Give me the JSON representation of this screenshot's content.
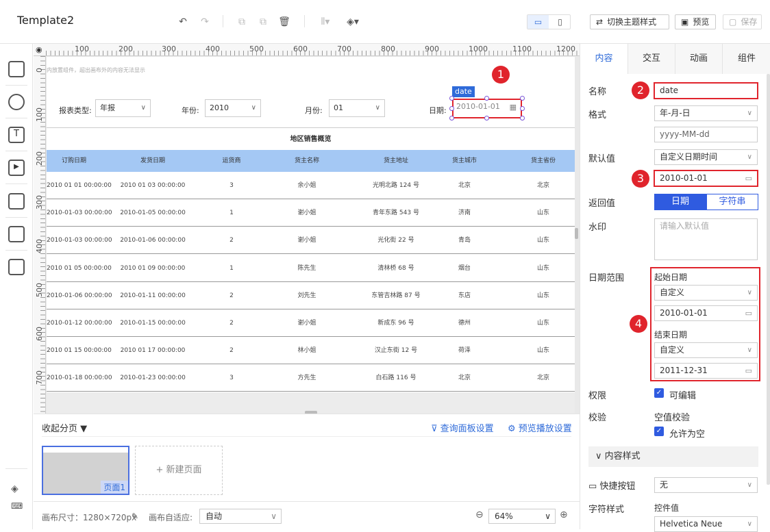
{
  "app": {
    "title": "Template2"
  },
  "toolbar": {
    "undo": "↶",
    "redo": "↷",
    "theme_label": "切换主题样式",
    "preview_label": "预览",
    "save_label": "保存"
  },
  "ruler": {
    "h_labels": [
      "100",
      "200",
      "300",
      "400",
      "500",
      "600",
      "700",
      "800",
      "900",
      "1000",
      "1100",
      "1200"
    ],
    "v_labels": [
      "0",
      "100",
      "200",
      "300",
      "400",
      "500",
      "600",
      "700"
    ]
  },
  "report": {
    "hint": "内放置组件，超出画布外的内容无法显示",
    "query": {
      "type_label": "报表类型:",
      "type_value": "年报",
      "year_label": "年份:",
      "year_value": "2010",
      "month_label": "月份:",
      "month_value": "01",
      "date_label": "日期:",
      "date_value": "2010-01-01",
      "date_tag": "date"
    },
    "table_title": "地区销售概览",
    "columns": [
      "订购日期",
      "发货日期",
      "运货商",
      "货主名称",
      "货主地址",
      "货主城市",
      "货主省份"
    ],
    "rows": [
      [
        "2010 01 01 00:00:00",
        "2010 01 03 00:00:00",
        "3",
        "余小姐",
        "光明北路 124 号",
        "北京",
        "北京"
      ],
      [
        "2010-01-03 00:00:00",
        "2010-01-05 00:00:00",
        "1",
        "谢小姐",
        "青年东路 543 号",
        "济南",
        "山东"
      ],
      [
        "2010-01-03 00:00:00",
        "2010-01-06 00:00:00",
        "2",
        "谢小姐",
        "光化街 22 号",
        "青岛",
        "山东"
      ],
      [
        "2010 01 05 00:00:00",
        "2010 01 09 00:00:00",
        "1",
        "陈先生",
        "清林桥 68 号",
        "烟台",
        "山东"
      ],
      [
        "2010-01-06 00:00:00",
        "2010-01-11 00:00:00",
        "2",
        "刘先生",
        "东管吉林路 87 号",
        "东店",
        "山东"
      ],
      [
        "2010-01-12 00:00:00",
        "2010-01-15 00:00:00",
        "2",
        "谢小姐",
        "新成东 96 号",
        "德州",
        "山东"
      ],
      [
        "2010 01 15 00:00:00",
        "2010 01 17 00:00:00",
        "2",
        "林小姐",
        "汉止东街 12 号",
        "荷泽",
        "山东"
      ],
      [
        "2010-01-18 00:00:00",
        "2010-01-23 00:00:00",
        "3",
        "方先生",
        "白石路 116 号",
        "北京",
        "北京"
      ]
    ]
  },
  "pages": {
    "collapse_label": "收起分页 ▼",
    "query_panel_label": "查询面板设置",
    "preview_play_label": "预览播放设置",
    "thumb_label": "页面1",
    "new_page_label": "+ 新建页面"
  },
  "status": {
    "canvas_size": "画布尺寸：1280×720px",
    "adapt_label": "画布自适应:",
    "adapt_value": "自动",
    "zoom_value": "64%"
  },
  "panel": {
    "tabs": [
      "内容",
      "交互",
      "动画",
      "组件"
    ],
    "name_label": "名称",
    "name_value": "date",
    "format_label": "格式",
    "format_value": "年-月-日",
    "format_pattern": "yyyy-MM-dd",
    "default_label": "默认值",
    "default_type": "自定义日期时间",
    "default_value": "2010-01-01",
    "return_label": "返回值",
    "return_date": "日期",
    "return_string": "字符串",
    "watermark_label": "水印",
    "watermark_placeholder": "请输入默认值",
    "range_label": "日期范围",
    "start_label": "起始日期",
    "start_type": "自定义",
    "start_value": "2010-01-01",
    "end_label": "结束日期",
    "end_type": "自定义",
    "end_value": "2011-12-31",
    "perm_label": "权限",
    "perm_value": "可编辑",
    "verify_label": "校验",
    "verify_sub": "空值校验",
    "verify_value": "允许为空",
    "content_style": "内容样式",
    "shortcut_label": "快捷按钮",
    "shortcut_value": "无",
    "font_label": "字符样式",
    "font_sub": "控件值",
    "font_value": "Helvetica Neue"
  },
  "annotations": [
    "1",
    "2",
    "3",
    "4"
  ],
  "colors": {
    "accent": "#2f6bd9",
    "highlight": "#e0242c",
    "header_blue": "#a4c8f4"
  }
}
